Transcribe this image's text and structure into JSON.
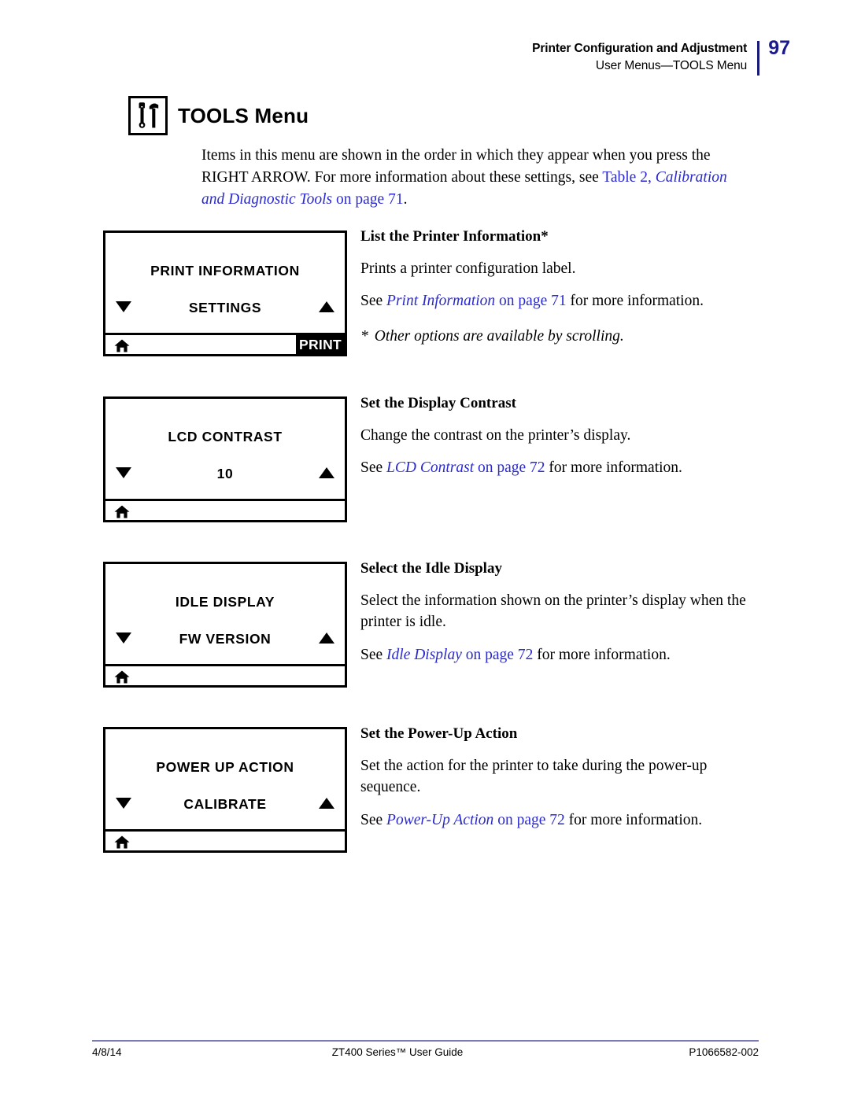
{
  "header": {
    "line1": "Printer Configuration and Adjustment",
    "line2": "User Menus—TOOLS Menu",
    "page_number": "97",
    "rule_color": "#1a1a7a"
  },
  "title": {
    "icon": "tools-wrench-hammer-icon",
    "text": "TOOLS Menu"
  },
  "intro": {
    "part1": "Items in this menu are shown in the order in which they appear when you press the RIGHT ARROW. For more information about these settings, see ",
    "link_plain": "Table 2, ",
    "link_italic": "Calibration and Diagnostic Tools",
    "link_tail": " on page ",
    "link_page": "71",
    "part_end": "."
  },
  "entries": [
    {
      "lcd": {
        "title": "PRINT INFORMATION",
        "value": "SETTINGS",
        "down_arrow": "▼",
        "up_arrow": "▲",
        "home_icon": "home-icon",
        "action_label": "PRINT",
        "has_action": true
      },
      "heading": "List the Printer Information*",
      "body": "Prints a printer configuration label.",
      "see_prefix": "See ",
      "see_link_italic": "Print Information",
      "see_link_tail": " on page ",
      "see_page": "71",
      "see_suffix": " for more information.",
      "note_star": "*",
      "note": "Other options are available by scrolling."
    },
    {
      "lcd": {
        "title": "LCD CONTRAST",
        "value": "10",
        "down_arrow": "▼",
        "up_arrow": "▲",
        "home_icon": "home-icon",
        "action_label": "",
        "has_action": false
      },
      "heading": "Set the Display Contrast",
      "body": "Change the contrast on the printer’s display.",
      "see_prefix": "See ",
      "see_link_italic": "LCD Contrast",
      "see_link_tail": " on page ",
      "see_page": "72",
      "see_suffix": " for more information.",
      "note_star": "",
      "note": ""
    },
    {
      "lcd": {
        "title": "IDLE DISPLAY",
        "value": "FW VERSION",
        "down_arrow": "▼",
        "up_arrow": "▲",
        "home_icon": "home-icon",
        "action_label": "",
        "has_action": false
      },
      "heading": "Select the Idle Display",
      "body": "Select the information shown on the printer’s display when the printer is idle.",
      "see_prefix": "See ",
      "see_link_italic": "Idle Display",
      "see_link_tail": " on page ",
      "see_page": "72",
      "see_suffix": " for more information.",
      "note_star": "",
      "note": ""
    },
    {
      "lcd": {
        "title": "POWER UP ACTION",
        "value": "CALIBRATE",
        "down_arrow": "▼",
        "up_arrow": "▲",
        "home_icon": "home-icon",
        "action_label": "",
        "has_action": false
      },
      "heading": "Set the Power-Up Action",
      "body": "Set the action for the printer to take during the power-up sequence.",
      "see_prefix": "See ",
      "see_link_italic": "Power-Up Action",
      "see_link_tail": " on page ",
      "see_page": "72",
      "see_suffix": " for more information.",
      "note_star": "",
      "note": ""
    }
  ],
  "footer": {
    "date": "4/8/14",
    "guide": "ZT400 Series™ User Guide",
    "part_number": "P1066582-002",
    "rule_color": "#7a7ab5"
  },
  "colors": {
    "link": "#2a2ad0",
    "page_number": "#1a1a8c",
    "ink": "#000000",
    "paper": "#ffffff"
  }
}
